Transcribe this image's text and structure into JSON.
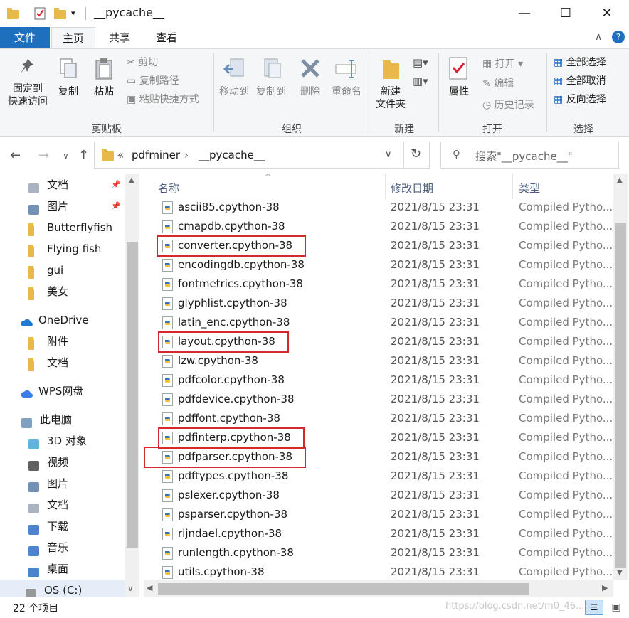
{
  "window": {
    "title": "__pycache__",
    "minimize": "—",
    "maximize": "☐",
    "close": "✕"
  },
  "ribbon_tabs": {
    "file": "文件",
    "home": "主页",
    "share": "共享",
    "view": "查看"
  },
  "clipboard": {
    "pin_quick_access": "固定到\n快速访问",
    "copy": "复制",
    "paste": "粘贴",
    "cut": "剪切",
    "copy_path": "复制路径",
    "paste_shortcut": "粘贴快捷方式",
    "group_label": "剪贴板"
  },
  "organize": {
    "move_to": "移动到",
    "copy_to": "复制到",
    "delete": "删除",
    "rename": "重命名",
    "group_label": "组织"
  },
  "new": {
    "new_folder": "新建\n文件夹",
    "group_label": "新建"
  },
  "open": {
    "properties": "属性",
    "open": "打开",
    "edit": "编辑",
    "history": "历史记录",
    "group_label": "打开"
  },
  "select": {
    "select_all": "全部选择",
    "select_none": "全部取消",
    "invert": "反向选择",
    "group_label": "选择"
  },
  "address": {
    "prefix": "«",
    "crumb1": "pdfminer",
    "crumb2": "__pycache__",
    "search_placeholder": "搜索\"__pycache__\""
  },
  "nav": [
    {
      "label": "文档",
      "icon": "document-icon",
      "pinned": true
    },
    {
      "label": "图片",
      "icon": "picture-icon",
      "pinned": true
    },
    {
      "label": "Butterflyfish",
      "icon": "folder-icon"
    },
    {
      "label": "Flying fish",
      "icon": "folder-icon"
    },
    {
      "label": "gui",
      "icon": "folder-icon"
    },
    {
      "label": "美女",
      "icon": "folder-icon"
    },
    {
      "label": "OneDrive",
      "icon": "onedrive-icon"
    },
    {
      "label": "附件",
      "icon": "folder-icon"
    },
    {
      "label": "文档",
      "icon": "folder-icon"
    },
    {
      "label": "WPS网盘",
      "icon": "wps-cloud-icon"
    },
    {
      "label": "此电脑",
      "icon": "computer-icon"
    },
    {
      "label": "3D 对象",
      "icon": "cube-icon"
    },
    {
      "label": "视频",
      "icon": "video-icon"
    },
    {
      "label": "图片",
      "icon": "picture-icon"
    },
    {
      "label": "文档",
      "icon": "document-icon"
    },
    {
      "label": "下载",
      "icon": "download-icon"
    },
    {
      "label": "音乐",
      "icon": "music-icon"
    },
    {
      "label": "桌面",
      "icon": "desktop-icon"
    },
    {
      "label": "OS (C:)",
      "icon": "drive-icon"
    }
  ],
  "columns": {
    "name": "名称",
    "date": "修改日期",
    "type": "类型"
  },
  "files": [
    {
      "name": "ascii85.cpython-38",
      "date": "2021/8/15 23:31",
      "type": "Compiled Pytho..."
    },
    {
      "name": "cmapdb.cpython-38",
      "date": "2021/8/15 23:31",
      "type": "Compiled Pytho..."
    },
    {
      "name": "converter.cpython-38",
      "date": "2021/8/15 23:31",
      "type": "Compiled Pytho..."
    },
    {
      "name": "encodingdb.cpython-38",
      "date": "2021/8/15 23:31",
      "type": "Compiled Pytho..."
    },
    {
      "name": "fontmetrics.cpython-38",
      "date": "2021/8/15 23:31",
      "type": "Compiled Pytho..."
    },
    {
      "name": "glyphlist.cpython-38",
      "date": "2021/8/15 23:31",
      "type": "Compiled Pytho..."
    },
    {
      "name": "latin_enc.cpython-38",
      "date": "2021/8/15 23:31",
      "type": "Compiled Pytho..."
    },
    {
      "name": "layout.cpython-38",
      "date": "2021/8/15 23:31",
      "type": "Compiled Pytho..."
    },
    {
      "name": "lzw.cpython-38",
      "date": "2021/8/15 23:31",
      "type": "Compiled Pytho..."
    },
    {
      "name": "pdfcolor.cpython-38",
      "date": "2021/8/15 23:31",
      "type": "Compiled Pytho..."
    },
    {
      "name": "pdfdevice.cpython-38",
      "date": "2021/8/15 23:31",
      "type": "Compiled Pytho..."
    },
    {
      "name": "pdffont.cpython-38",
      "date": "2021/8/15 23:31",
      "type": "Compiled Pytho..."
    },
    {
      "name": "pdfinterp.cpython-38",
      "date": "2021/8/15 23:31",
      "type": "Compiled Pytho..."
    },
    {
      "name": "pdfparser.cpython-38",
      "date": "2021/8/15 23:31",
      "type": "Compiled Pytho..."
    },
    {
      "name": "pdftypes.cpython-38",
      "date": "2021/8/15 23:31",
      "type": "Compiled Pytho..."
    },
    {
      "name": "pslexer.cpython-38",
      "date": "2021/8/15 23:31",
      "type": "Compiled Pytho..."
    },
    {
      "name": "psparser.cpython-38",
      "date": "2021/8/15 23:31",
      "type": "Compiled Pytho..."
    },
    {
      "name": "rijndael.cpython-38",
      "date": "2021/8/15 23:31",
      "type": "Compiled Pytho..."
    },
    {
      "name": "runlength.cpython-38",
      "date": "2021/8/15 23:31",
      "type": "Compiled Pytho..."
    },
    {
      "name": "utils.cpython-38",
      "date": "2021/8/15 23:31",
      "type": "Compiled Pytho..."
    }
  ],
  "status": {
    "item_count": "22 个项目",
    "watermark": "https://blog.csdn.net/m0_46..."
  },
  "colors": {
    "file_tab": "#1f6fbf",
    "highlight_box": "#d62a2a",
    "folder": "#e8b84a"
  }
}
